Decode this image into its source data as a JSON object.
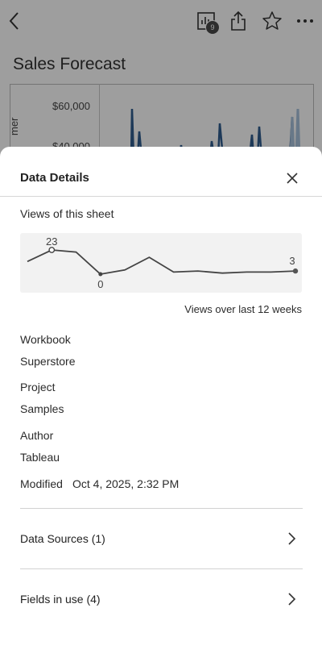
{
  "app": {
    "page_title": "Sales Forecast",
    "badge_count": "9",
    "y_ticks": [
      "$60,000",
      "$40,000"
    ],
    "y_axis_fragment": "mer"
  },
  "sheet": {
    "title": "Data Details",
    "views_label": "Views of this sheet",
    "views_caption": "Views over last 12 weeks",
    "sparkline": {
      "values": [
        12,
        23,
        21,
        0,
        4,
        16,
        2,
        3,
        1,
        2,
        2,
        3
      ],
      "max_label": "23",
      "min_label": "0",
      "last_label": "3"
    },
    "details": {
      "workbook_label": "Workbook",
      "workbook_value": "Superstore",
      "project_label": "Project",
      "project_value": "Samples",
      "author_label": "Author",
      "author_value": "Tableau",
      "modified_label": "Modified",
      "modified_value": "Oct 4, 2025, 2:32 PM"
    },
    "rows": {
      "data_sources": "Data Sources (1)",
      "fields_in_use": "Fields in use (4)"
    }
  },
  "colors": {
    "chart_dark": "#2f5d8f",
    "chart_light": "#a9c2dc",
    "scrim": "rgba(0,0,0,0.38)"
  }
}
